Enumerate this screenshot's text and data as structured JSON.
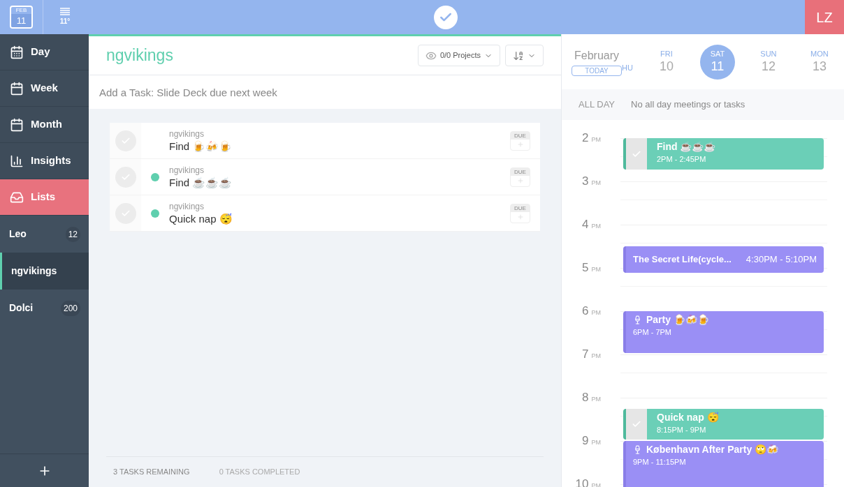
{
  "topbar": {
    "date_month": "FEB",
    "date_day": "11",
    "weather": "11°",
    "avatar": "LZ"
  },
  "nav_items": [
    {
      "label": "Day",
      "selected": false
    },
    {
      "label": "Week",
      "selected": false
    },
    {
      "label": "Month",
      "selected": false
    },
    {
      "label": "Insights",
      "selected": false
    },
    {
      "label": "Lists",
      "selected": true
    }
  ],
  "projects": [
    {
      "name": "Leo",
      "count": "12",
      "selected": false
    },
    {
      "name": "ngvikings",
      "selected": true
    },
    {
      "name": "Dolci",
      "count": "200",
      "selected": false
    }
  ],
  "list": {
    "title": "ngvikings",
    "filter": "0/0 Projects",
    "add_placeholder": "Add a Task: Slide Deck due next week",
    "tasks": [
      {
        "project": "ngvikings",
        "title": "Find 🍺🍻🍺",
        "checked": false,
        "scheduled": false,
        "due": "DUE"
      },
      {
        "project": "ngvikings",
        "title": "Find ☕☕☕",
        "checked": false,
        "scheduled": true,
        "due": "DUE"
      },
      {
        "project": "ngvikings",
        "title": "Quick nap 😴",
        "checked": false,
        "scheduled": true,
        "due": "DUE"
      }
    ],
    "remaining": "3 TASKS REMAINING",
    "completed": "0 TASKS COMPLETED"
  },
  "calendar": {
    "month": "February",
    "today": "TODAY",
    "days": [
      {
        "weekday": "HU",
        "selected": false
      },
      {
        "weekday": "FRI",
        "date": "10",
        "selected": false
      },
      {
        "weekday": "SAT",
        "date": "11",
        "selected": true
      },
      {
        "weekday": "SUN",
        "date": "12",
        "selected": false
      },
      {
        "weekday": "MON",
        "date": "13",
        "selected": false
      }
    ],
    "all_day_label": "ALL DAY",
    "all_day_text": "No all day meetings or tasks",
    "hours": [
      {
        "hour": "2",
        "period": "PM"
      },
      {
        "hour": "3",
        "period": "PM"
      },
      {
        "hour": "4",
        "period": "PM"
      },
      {
        "hour": "5",
        "period": "PM"
      },
      {
        "hour": "6",
        "period": "PM"
      },
      {
        "hour": "7",
        "period": "PM"
      },
      {
        "hour": "8",
        "period": "PM"
      },
      {
        "hour": "9",
        "period": "PM"
      },
      {
        "hour": "10",
        "period": "PM"
      }
    ],
    "events": [
      {
        "kind": "task",
        "title": "Find ☕☕☕",
        "time": "2PM - 2:45PM",
        "checked": false
      },
      {
        "kind": "short_event",
        "title": "The Secret Life(cycle...",
        "time": "4:30PM - 5:10PM"
      },
      {
        "kind": "party",
        "title": "Party 🍺🍻🍺",
        "time": "6PM - 7PM"
      },
      {
        "kind": "task",
        "title": "Quick nap 😴",
        "time": "8:15PM - 9PM",
        "checked": false
      },
      {
        "kind": "party",
        "title": "København After Party 🙄🍻",
        "time": "9PM - 11:15PM"
      }
    ]
  }
}
